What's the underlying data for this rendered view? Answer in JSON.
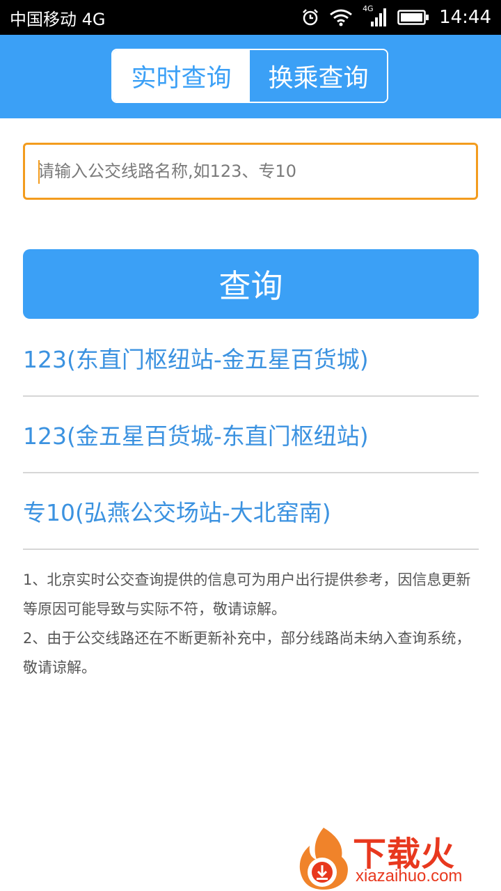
{
  "status_bar": {
    "carrier": "中国移动 4G",
    "network_badge": "4G",
    "time": "14:44"
  },
  "tabs": [
    {
      "label": "实时查询",
      "active": true
    },
    {
      "label": "换乘查询",
      "active": false
    }
  ],
  "search": {
    "placeholder": "请输入公交线路名称,如123、专10",
    "value": ""
  },
  "query_button": {
    "label": "查询"
  },
  "results": [
    "123(东直门枢纽站-金五星百货城)",
    "123(金五星百货城-东直门枢纽站)",
    "专10(弘燕公交场站-大北窑南)"
  ],
  "notes": [
    "1、北京实时公交查询提供的信息可为用户出行提供参考，因信息更新等原因可能导致与实际不符，敬请谅解。",
    "2、由于公交线路还在不断更新补充中，部分线路尚未纳入查询系统，敬请谅解。"
  ],
  "watermark": {
    "brand": "下载火",
    "site": "xiazaihuo.com"
  },
  "colors": {
    "primary": "#3ba0f6",
    "link": "#3b92e0",
    "input_border": "#f39c1e",
    "watermark": "#e8381e"
  }
}
